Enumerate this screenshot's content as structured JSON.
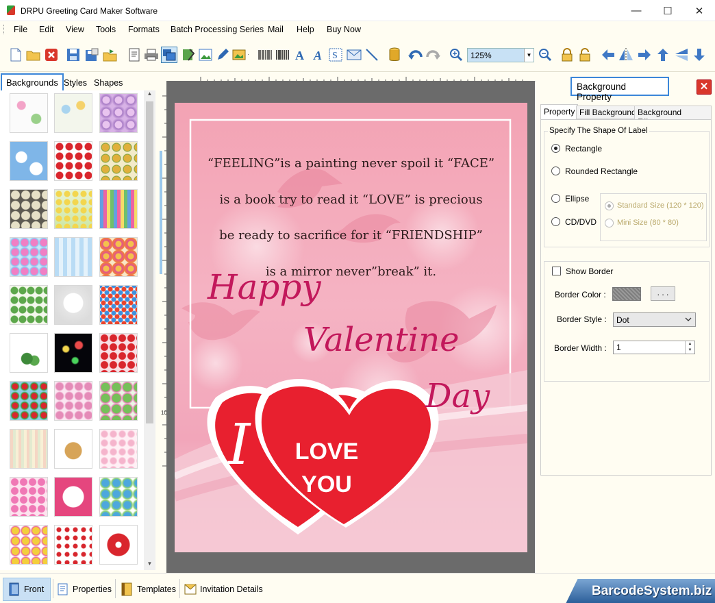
{
  "window": {
    "title": "DRPU Greeting Card Maker Software",
    "buttons": [
      "—",
      "☐",
      "✕"
    ]
  },
  "menu": [
    "File",
    "Edit",
    "View",
    "Tools",
    "Formats",
    "Batch Processing Series",
    "Mail",
    "Help",
    "Buy Now"
  ],
  "toolbar": {
    "zoom": "125%"
  },
  "left_panel": {
    "tabs": [
      "Backgrounds",
      "Styles",
      "Shapes"
    ],
    "active_tab": "Backgrounds"
  },
  "ruler": {
    "left_mark": "10"
  },
  "card": {
    "lines": [
      "“FEELING”is a painting never spoil it “FACE”",
      "is a book try to read it “LOVE” is precious",
      "be ready to sacrifice for it “FRIENDSHIP”",
      "is a mirror never”break” it."
    ],
    "happy": "Happy",
    "valentine": "Valentine",
    "day": "Day",
    "heart_letter": "I",
    "love": "LOVE",
    "you": "YOU"
  },
  "right_panel": {
    "title": "Background Property",
    "tabs": [
      "Property",
      "Fill Background",
      "Background Effects"
    ],
    "shape_group_label": "Specify The Shape Of Label",
    "shapes": [
      "Rectangle",
      "Rounded Rectangle",
      "Ellipse",
      "CD/DVD"
    ],
    "selected_shape": "Rectangle",
    "cd_sizes": [
      "Standard Size (120 * 120)",
      "Mini Size (80 * 80)"
    ],
    "show_border_label": "Show Border",
    "border_color_label": "Border Color :",
    "dots_button": ". . .",
    "border_style_label": "Border Style :",
    "border_style_value": "Dot",
    "border_width_label": "Border Width :",
    "border_width_value": "1"
  },
  "statusbar": {
    "items": [
      "Front",
      "Properties",
      "Templates",
      "Invitation Details"
    ],
    "brand": "BarcodeSystem.biz"
  },
  "colors": {
    "accent_blue": "#3b86d9",
    "card_pink": "#f4a7b9",
    "heart_red": "#e8202f",
    "script_magenta": "#c2185b"
  }
}
